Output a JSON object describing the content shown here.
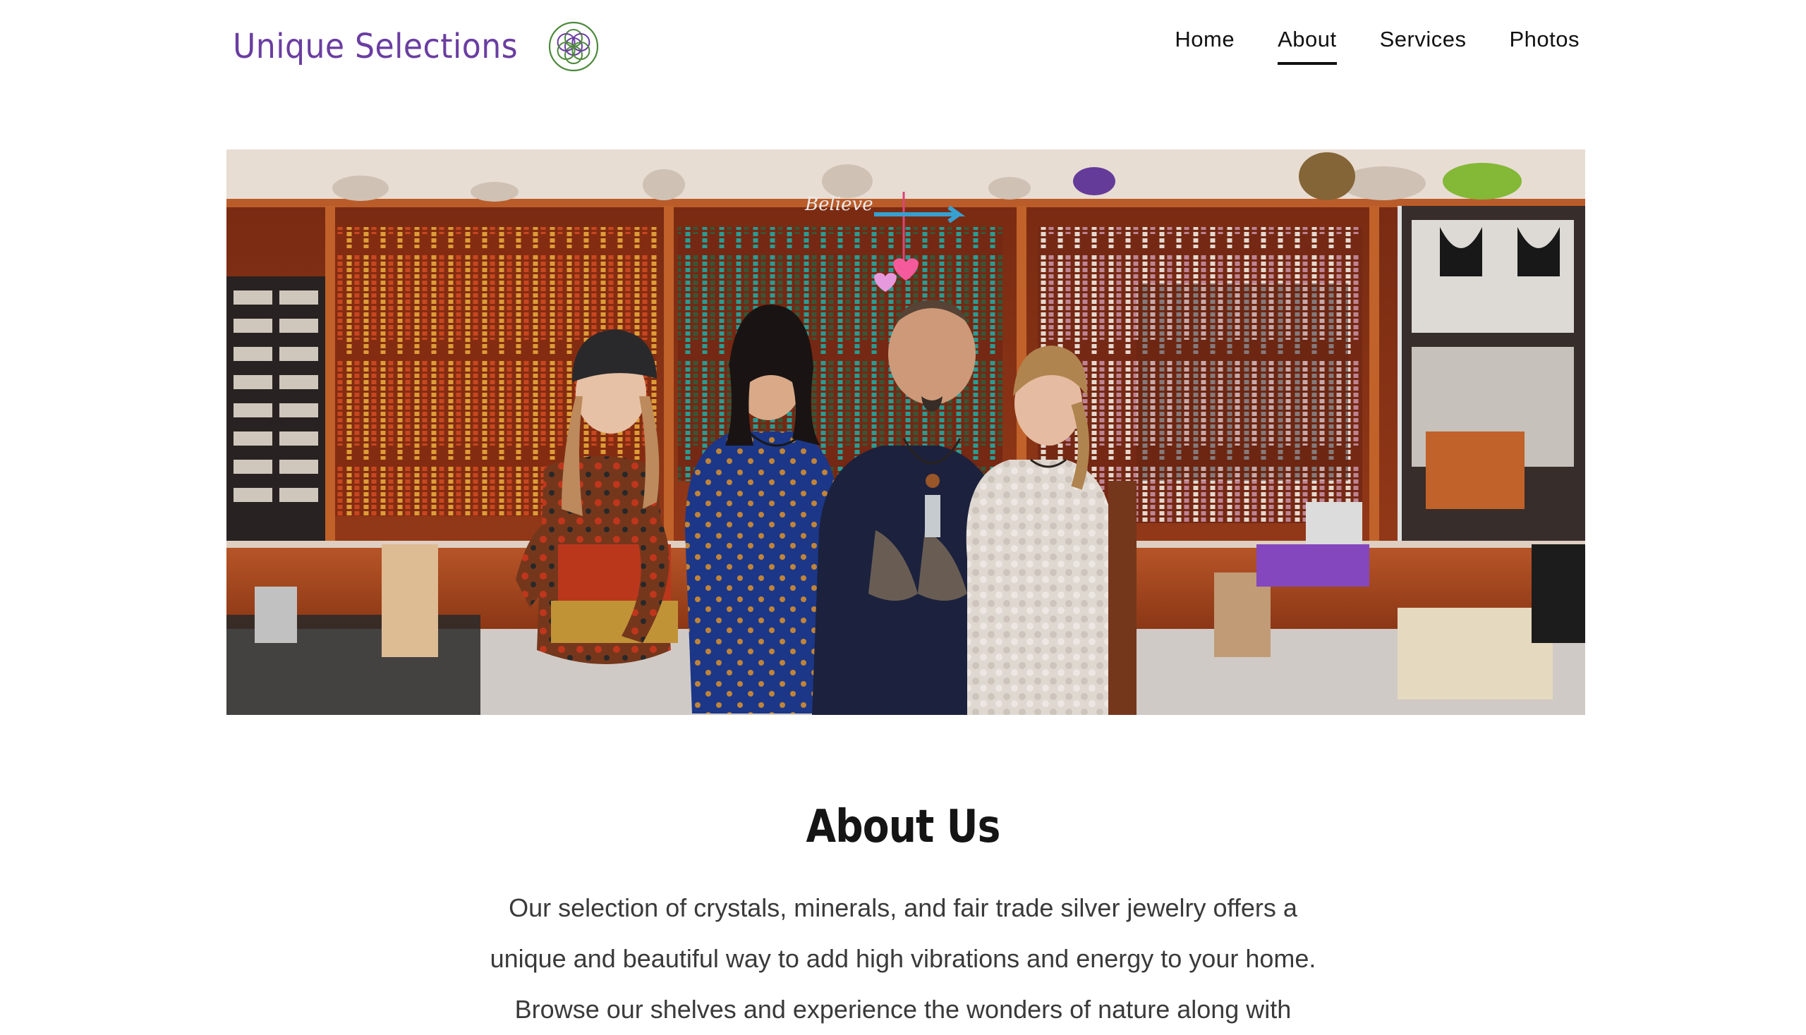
{
  "header": {
    "logo_text": "Unique Selections",
    "logo_icon": "flower-of-life-icon",
    "nav": [
      {
        "label": "Home",
        "active": false
      },
      {
        "label": "About",
        "active": true
      },
      {
        "label": "Services",
        "active": false
      },
      {
        "label": "Photos",
        "active": false
      }
    ]
  },
  "hero": {
    "description_icon": "team-photo-in-crystal-shop",
    "sign_text": "Believe"
  },
  "about": {
    "title": "About Us",
    "lines": [
      "Our selection of crystals, minerals, and fair trade silver jewelry offers a",
      "unique and beautiful way to add high vibrations and energy to your home.",
      "Browse our shelves and experience the wonders of nature along with"
    ]
  },
  "colors": {
    "brand_purple": "#6a3ea1",
    "logo_green": "#4d8a3c",
    "nav_text": "#111111",
    "body_text": "#3a3a3a",
    "shelf_wood": "#b5532a"
  }
}
